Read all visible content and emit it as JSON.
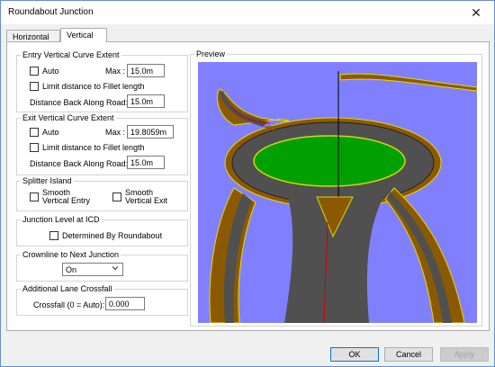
{
  "window": {
    "title": "Roundabout Junction",
    "close_glyph": "✕"
  },
  "tabs": [
    {
      "label": "Horizontal",
      "active": false
    },
    {
      "label": "Vertical",
      "active": true
    }
  ],
  "entry": {
    "group_label": "Entry Vertical Curve Extent",
    "auto_label": "Auto",
    "auto_checked": false,
    "max_label": "Max :",
    "max_value": "15.0m",
    "limit_label": "Limit distance to Fillet length",
    "limit_checked": false,
    "distance_label": "Distance Back Along Road:",
    "distance_value": "15.0m"
  },
  "exit": {
    "group_label": "Exit Vertical Curve Extent",
    "auto_label": "Auto",
    "auto_checked": false,
    "max_label": "Max :",
    "max_value": "19.8059m",
    "limit_label": "Limit distance to Fillet length",
    "limit_checked": false,
    "distance_label": "Distance Back Along Road:",
    "distance_value": "15.0m"
  },
  "splitter": {
    "group_label": "Splitter Island",
    "smooth_entry_line1": "Smooth",
    "smooth_entry_line2": "Vertical Entry",
    "smooth_exit_line1": "Smooth",
    "smooth_exit_line2": "Vertical Exit"
  },
  "junction_level": {
    "group_label": "Junction Level at ICD",
    "determined_label": "Determined By Roundabout"
  },
  "crownline": {
    "group_label": "Crownline to Next Junction",
    "selected": "On"
  },
  "crossfall": {
    "group_label": "Additional Lane Crossfall",
    "label": "Crossfall (0 = Auto):",
    "value": "0.000"
  },
  "preview": {
    "group_label": "Preview",
    "background": "#8080ff",
    "road_color": "#505050",
    "verge_color": "#8b5a00",
    "island_color": "#009900"
  },
  "buttons": {
    "ok": "OK",
    "cancel": "Cancel",
    "apply": "Apply"
  }
}
